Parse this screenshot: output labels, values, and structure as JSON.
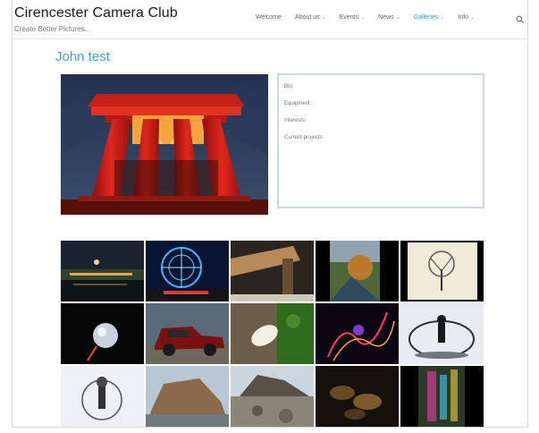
{
  "site": {
    "title": "Cirencester Camera Club",
    "tagline": "Create Better Pictures..."
  },
  "nav": {
    "items": [
      {
        "label": "Welcome",
        "has_dropdown": false,
        "active": false
      },
      {
        "label": "About us",
        "has_dropdown": true,
        "active": false
      },
      {
        "label": "Events",
        "has_dropdown": true,
        "active": false
      },
      {
        "label": "News",
        "has_dropdown": true,
        "active": false
      },
      {
        "label": "Galleries",
        "has_dropdown": true,
        "active": true
      },
      {
        "label": "Info",
        "has_dropdown": true,
        "active": false
      }
    ],
    "search_icon": "search-icon",
    "active_color": "#2f9fd8"
  },
  "page": {
    "title": "John test",
    "title_color": "#3fa6e0"
  },
  "profile": {
    "bio_label": "Bio:",
    "equipment_label": "Equipment:",
    "interests_label": "Interests:",
    "current_projects_label": "Current projects:"
  },
  "gallery": {
    "thumbnails": [
      "night-harbour",
      "ferris-wheel",
      "wooden-post",
      "autumn-river",
      "tree-sketch",
      "glass-sphere",
      "vintage-car",
      "white-flower",
      "light-painting",
      "crystal-ball-figure",
      "crystal-ball-portrait",
      "coastal-rock",
      "rocky-shore",
      "dark-leaves",
      "colour-abstract"
    ]
  }
}
